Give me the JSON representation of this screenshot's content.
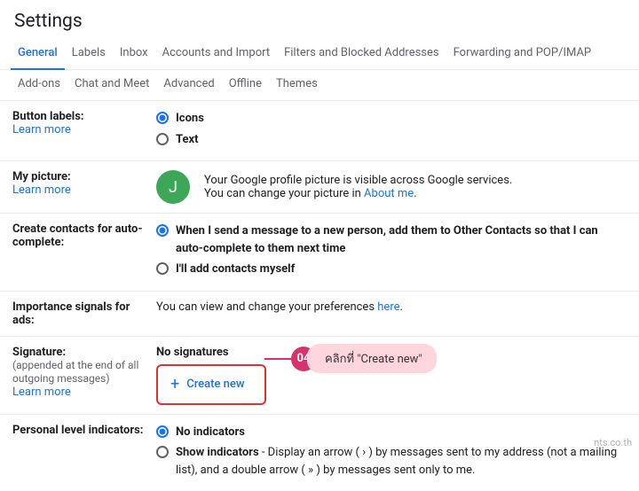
{
  "title": "Settings",
  "tabs_row1": [
    "General",
    "Labels",
    "Inbox",
    "Accounts and Import",
    "Filters and Blocked Addresses",
    "Forwarding and POP/IMAP"
  ],
  "tabs_row2": [
    "Add-ons",
    "Chat and Meet",
    "Advanced",
    "Offline",
    "Themes"
  ],
  "active_tab": "General",
  "button_labels": {
    "label": "Button labels:",
    "learn_more": "Learn more",
    "options": [
      "Icons",
      "Text"
    ],
    "selected": 0
  },
  "my_picture": {
    "label": "My picture:",
    "learn_more": "Learn more",
    "avatar_letter": "J",
    "desc1": "Your Google profile picture is visible across Google services.",
    "desc2a": "You can change your picture in ",
    "about_me": "About me",
    "desc2b": "."
  },
  "auto_contacts": {
    "label": "Create contacts for auto-complete:",
    "options": [
      "When I send a message to a new person, add them to Other Contacts so that I can auto-complete to them next time",
      "I'll add contacts myself"
    ],
    "selected": 0
  },
  "importance": {
    "label": "Importance signals for ads:",
    "desc_a": "You can view and change your preferences ",
    "here": "here",
    "desc_b": "."
  },
  "signature": {
    "label": "Signature:",
    "sub": "(appended at the end of all outgoing messages)",
    "learn_more": "Learn more",
    "no_sig": "No signatures",
    "create_new": "Create new"
  },
  "personal_level": {
    "label": "Personal level indicators:",
    "options": [
      {
        "bold": "No indicators",
        "rest": ""
      },
      {
        "bold": "Show indicators",
        "rest": " - Display an arrow ( › ) by messages sent to my address (not a mailing list), and a double arrow ( » ) by messages sent only to me."
      }
    ],
    "selected": 0
  },
  "annotation": {
    "num": "04",
    "text": "คลิกที่ \"Create new\""
  },
  "watermark": "nts.co.th"
}
